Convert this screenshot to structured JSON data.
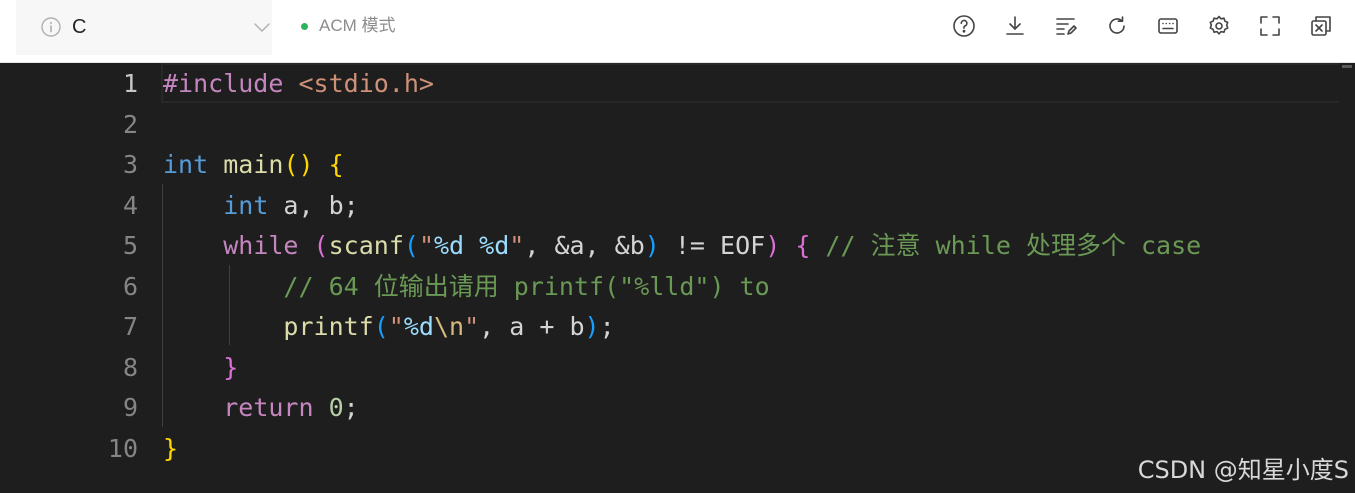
{
  "toolbar": {
    "language": "C",
    "mode_label": "ACM 模式",
    "icons": [
      "help-icon",
      "download-icon",
      "format-icon",
      "reset-icon",
      "keyboard-icon",
      "settings-icon",
      "fullscreen-icon",
      "close-panel-icon"
    ]
  },
  "editor": {
    "line_numbers": [
      "1",
      "2",
      "3",
      "4",
      "5",
      "6",
      "7",
      "8",
      "9",
      "10"
    ],
    "lines": [
      [
        {
          "t": "#include",
          "c": "t-pp"
        },
        {
          "t": " ",
          "c": "t-var"
        },
        {
          "t": "<stdio.h>",
          "c": "t-inc"
        }
      ],
      [],
      [
        {
          "t": "int",
          "c": "t-kw"
        },
        {
          "t": " ",
          "c": "t-var"
        },
        {
          "t": "main",
          "c": "t-fn"
        },
        {
          "t": "()",
          "c": "b1"
        },
        {
          "t": " ",
          "c": "t-var"
        },
        {
          "t": "{",
          "c": "b1"
        }
      ],
      [
        {
          "t": "    ",
          "c": "t-var"
        },
        {
          "t": "int",
          "c": "t-kw"
        },
        {
          "t": " a, b;",
          "c": "t-var"
        }
      ],
      [
        {
          "t": "    ",
          "c": "t-var"
        },
        {
          "t": "while",
          "c": "t-ctl"
        },
        {
          "t": " ",
          "c": "t-var"
        },
        {
          "t": "(",
          "c": "b2"
        },
        {
          "t": "scanf",
          "c": "t-fn"
        },
        {
          "t": "(",
          "c": "b3"
        },
        {
          "t": "\"",
          "c": "t-str"
        },
        {
          "t": "%d",
          "c": "t-fmt"
        },
        {
          "t": " ",
          "c": "t-str"
        },
        {
          "t": "%d",
          "c": "t-fmt"
        },
        {
          "t": "\"",
          "c": "t-str"
        },
        {
          "t": ", &a, &b",
          "c": "t-var"
        },
        {
          "t": ")",
          "c": "b3"
        },
        {
          "t": " != EOF",
          "c": "t-var"
        },
        {
          "t": ")",
          "c": "b2"
        },
        {
          "t": " ",
          "c": "t-var"
        },
        {
          "t": "{",
          "c": "b2"
        },
        {
          "t": " // 注意 while 处理多个 case",
          "c": "t-cm"
        }
      ],
      [
        {
          "t": "        ",
          "c": "t-var"
        },
        {
          "t": "// 64 位输出请用 printf(\"%lld\") to",
          "c": "t-cm"
        }
      ],
      [
        {
          "t": "        ",
          "c": "t-var"
        },
        {
          "t": "printf",
          "c": "t-fn"
        },
        {
          "t": "(",
          "c": "b3"
        },
        {
          "t": "\"",
          "c": "t-str"
        },
        {
          "t": "%d",
          "c": "t-fmt"
        },
        {
          "t": "\\n",
          "c": "t-esc"
        },
        {
          "t": "\"",
          "c": "t-str"
        },
        {
          "t": ", a + b",
          "c": "t-var"
        },
        {
          "t": ")",
          "c": "b3"
        },
        {
          "t": ";",
          "c": "t-var"
        }
      ],
      [
        {
          "t": "    ",
          "c": "t-var"
        },
        {
          "t": "}",
          "c": "b2"
        }
      ],
      [
        {
          "t": "    ",
          "c": "t-var"
        },
        {
          "t": "return",
          "c": "t-ctl"
        },
        {
          "t": " ",
          "c": "t-var"
        },
        {
          "t": "0",
          "c": "t-num"
        },
        {
          "t": ";",
          "c": "t-var"
        }
      ],
      [
        {
          "t": "}",
          "c": "b1"
        }
      ]
    ]
  },
  "watermark": "CSDN @知星小度S"
}
